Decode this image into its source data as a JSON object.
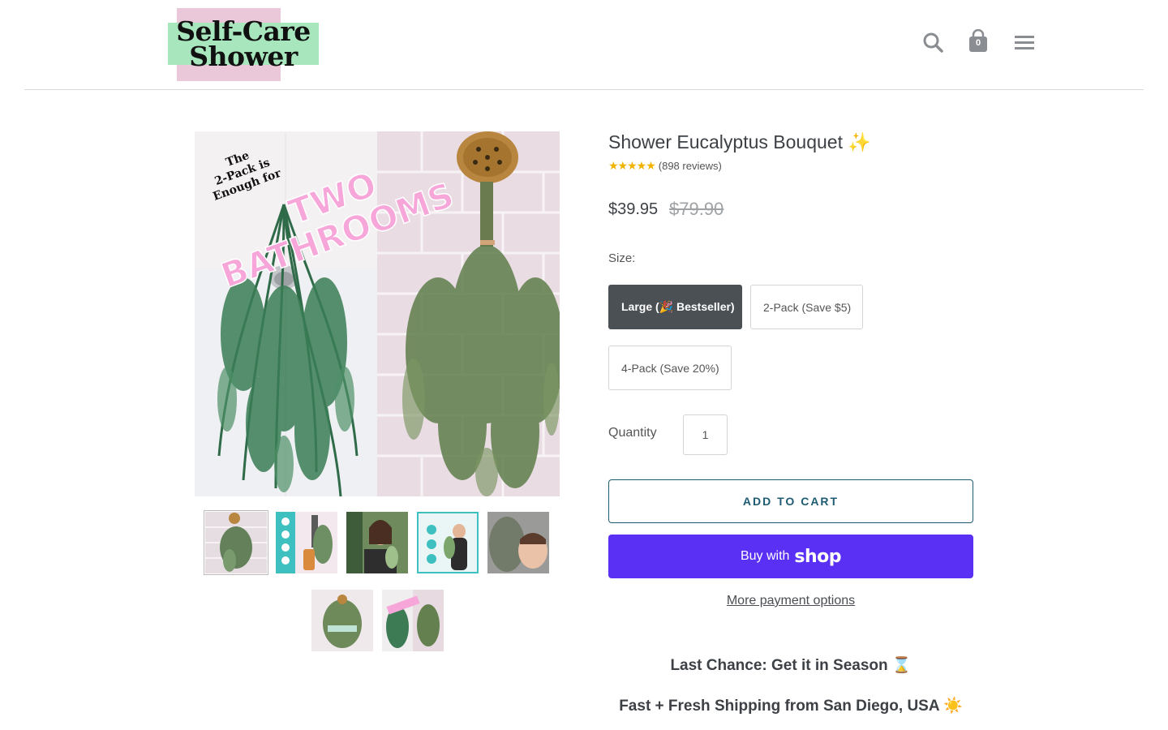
{
  "header": {
    "logo_line1": "Self-Care",
    "logo_line2": "Shower",
    "cart_count": "0"
  },
  "gallery": {
    "main_image_text": {
      "small": [
        "The",
        "2-Pack is",
        "Enough for"
      ],
      "big_line1": "TWO",
      "big_line2": "BATHROOMS"
    },
    "thumbnails": [
      {
        "name": "eucalyptus-on-tile"
      },
      {
        "name": "benefits-teal-panel"
      },
      {
        "name": "woman-holding-bouquet"
      },
      {
        "name": "benefits-infographic"
      },
      {
        "name": "face-close-up"
      },
      {
        "name": "bouquet-with-label"
      },
      {
        "name": "two-bathrooms-collage"
      }
    ]
  },
  "product": {
    "title": "Shower Eucalyptus Bouquet ✨",
    "stars": "★★★★★",
    "reviews": "(898 reviews)",
    "price": "$39.95",
    "compare_price": "$79.90",
    "size_label": "Size:",
    "variants": [
      {
        "label": "Large (🎉 Bestseller)",
        "selected": true
      },
      {
        "label": "2-Pack (Save $5)",
        "selected": false
      },
      {
        "label": "4-Pack (Save 20%)",
        "selected": false
      }
    ],
    "quantity_label": "Quantity",
    "quantity_value": "1",
    "add_to_cart": "ADD TO CART",
    "buy_with": "Buy with",
    "shop_word": "shop",
    "more_payment": "More payment options"
  },
  "promos": {
    "line1": "Last Chance: Get it in Season ⌛",
    "line2": "Fast + Fresh Shipping from San Diego, USA ☀️"
  },
  "colors": {
    "accent": "#1e5b73",
    "shop_pay": "#5a31f4",
    "selected_variant": "#4b5055",
    "logo_pink": "#ebc8d9",
    "logo_green": "#a8e6bd",
    "star": "#f0b400"
  }
}
